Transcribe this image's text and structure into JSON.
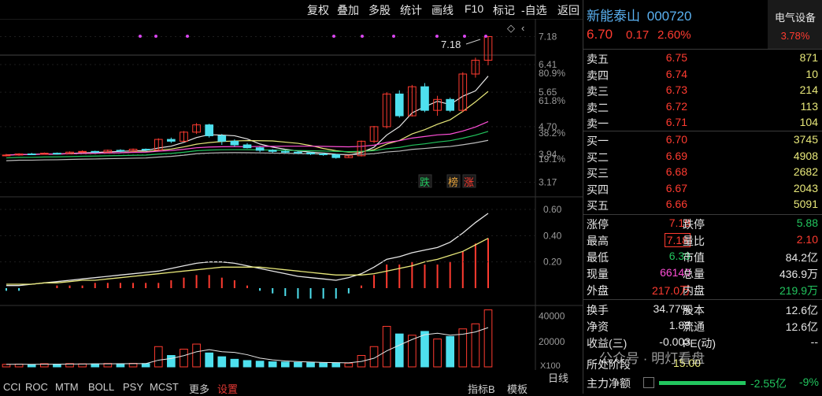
{
  "toolbar": {
    "buttons": [
      "复权",
      "叠加",
      "多股",
      "统计",
      "画线",
      "F10",
      "标记",
      "-自选",
      "返回"
    ]
  },
  "stock": {
    "name": "新能泰山",
    "code": "000720",
    "sector": "电气设备",
    "sector_change": "3.78%",
    "price": "6.70",
    "change": "0.17",
    "change_pct": "2.60%"
  },
  "order_book": {
    "asks": [
      {
        "label": "卖五",
        "price": "6.75",
        "vol": "871"
      },
      {
        "label": "卖四",
        "price": "6.74",
        "vol": "10"
      },
      {
        "label": "卖三",
        "price": "6.73",
        "vol": "214"
      },
      {
        "label": "卖二",
        "price": "6.72",
        "vol": "113"
      },
      {
        "label": "卖一",
        "price": "6.71",
        "vol": "104"
      }
    ],
    "bids": [
      {
        "label": "买一",
        "price": "6.70",
        "vol": "3745"
      },
      {
        "label": "买二",
        "price": "6.69",
        "vol": "4908"
      },
      {
        "label": "买三",
        "price": "6.68",
        "vol": "2682"
      },
      {
        "label": "买四",
        "price": "6.67",
        "vol": "2043"
      },
      {
        "label": "买五",
        "price": "6.66",
        "vol": "5091"
      }
    ]
  },
  "stats": [
    {
      "l1": "涨停",
      "v1": "7.18",
      "l2": "跌停",
      "v2": "5.88"
    },
    {
      "l1": "最高",
      "v1": "7.18",
      "l2": "量比",
      "v2": "2.10"
    },
    {
      "l1": "最低",
      "v1": "6.39",
      "l2": "市值",
      "v2": "84.2亿"
    },
    {
      "l1": "现量",
      "v1": "66140",
      "l2": "总量",
      "v2": "436.9万"
    },
    {
      "l1": "外盘",
      "v1": "217.0万",
      "l2": "内盘",
      "v2": "219.9万"
    }
  ],
  "fundamentals": [
    {
      "l1": "换手",
      "v1": "34.77%",
      "l2": "股本",
      "v2": "12.6亿"
    },
    {
      "l1": "净资",
      "v1": "1.88",
      "l2": "流通",
      "v2": "12.6亿"
    },
    {
      "l1": "收益(三)",
      "v1": "-0.003",
      "l2": "PE(动)",
      "v2": "--"
    }
  ],
  "footer_rows": {
    "stage_label": "所处阶段",
    "stage_value": "15.00",
    "watermark": "公众号 · 明灯看盘",
    "main_flow_label": "主力净额",
    "main_flow_value": "-2.55亿",
    "main_flow_pct": "-9%"
  },
  "bottom_tabs": {
    "tabs": [
      "CCI",
      "ROC",
      "MTM",
      "BOLL",
      "PSY",
      "MCST",
      "更多",
      "设置"
    ],
    "right_tabs": [
      "指标B",
      "模板"
    ],
    "day_label": "日线"
  },
  "chart_data": {
    "type": "candlestick",
    "price_axis": [
      "7.18",
      "6.41",
      "5.65",
      "4.70",
      "3.94",
      "3.17"
    ],
    "price_range": [
      2.9,
      7.45
    ],
    "pct_labels": [
      "80.9%",
      "61.8%",
      "38.2%",
      "19.1%"
    ],
    "max_marker": "7.18",
    "signal_labels": [
      "跌",
      "榜",
      "涨"
    ],
    "candles": [
      [
        3.9,
        3.92,
        3.88,
        3.95
      ],
      [
        3.92,
        3.95,
        3.9,
        3.97
      ],
      [
        3.95,
        3.94,
        3.92,
        3.98
      ],
      [
        3.94,
        3.97,
        3.93,
        3.99
      ],
      [
        3.97,
        3.96,
        3.93,
        3.99
      ],
      [
        3.96,
        4.0,
        3.95,
        4.02
      ],
      [
        4.0,
        4.02,
        3.98,
        4.05
      ],
      [
        4.02,
        4.0,
        3.97,
        4.04
      ],
      [
        4.0,
        4.05,
        3.99,
        4.07
      ],
      [
        4.05,
        4.03,
        4.0,
        4.08
      ],
      [
        4.03,
        4.08,
        4.02,
        4.1
      ],
      [
        4.08,
        4.06,
        4.03,
        4.1
      ],
      [
        4.06,
        4.35,
        4.05,
        4.38
      ],
      [
        4.35,
        4.3,
        4.25,
        4.4
      ],
      [
        4.3,
        4.55,
        4.28,
        4.58
      ],
      [
        4.55,
        4.75,
        4.5,
        4.8
      ],
      [
        4.75,
        4.45,
        4.4,
        4.78
      ],
      [
        4.45,
        4.3,
        4.2,
        4.5
      ],
      [
        4.3,
        4.2,
        4.15,
        4.35
      ],
      [
        4.2,
        4.12,
        4.1,
        4.25
      ],
      [
        4.12,
        4.05,
        4.0,
        4.15
      ],
      [
        4.05,
        4.02,
        3.98,
        4.08
      ],
      [
        4.02,
        4.0,
        3.96,
        4.05
      ],
      [
        4.0,
        3.98,
        3.95,
        4.03
      ],
      [
        3.98,
        3.95,
        3.92,
        4.0
      ],
      [
        3.95,
        3.93,
        3.9,
        3.98
      ],
      [
        3.93,
        3.85,
        3.82,
        3.95
      ],
      [
        3.85,
        3.9,
        3.84,
        3.92
      ],
      [
        3.9,
        4.3,
        3.88,
        4.32
      ],
      [
        4.3,
        4.7,
        4.25,
        4.72
      ],
      [
        4.7,
        5.6,
        4.65,
        5.65
      ],
      [
        5.6,
        5.0,
        4.95,
        5.7
      ],
      [
        5.0,
        5.8,
        4.98,
        5.85
      ],
      [
        5.8,
        5.15,
        5.1,
        5.9
      ],
      [
        5.15,
        5.45,
        5.0,
        5.55
      ],
      [
        5.45,
        5.15,
        5.1,
        5.5
      ],
      [
        5.15,
        6.15,
        5.1,
        6.2
      ],
      [
        6.15,
        6.53,
        6.05,
        6.6
      ],
      [
        6.53,
        7.18,
        6.39,
        7.18
      ]
    ],
    "macd_axis": [
      "0.60",
      "0.40",
      "0.20"
    ],
    "macd_range": [
      -0.12,
      0.66
    ],
    "dif": [
      0.02,
      0.02,
      0.03,
      0.04,
      0.05,
      0.06,
      0.07,
      0.08,
      0.09,
      0.1,
      0.11,
      0.12,
      0.13,
      0.15,
      0.17,
      0.19,
      0.2,
      0.2,
      0.19,
      0.17,
      0.15,
      0.13,
      0.11,
      0.09,
      0.08,
      0.07,
      0.06,
      0.08,
      0.11,
      0.16,
      0.22,
      0.24,
      0.27,
      0.29,
      0.31,
      0.35,
      0.42,
      0.5,
      0.57
    ],
    "dea": [
      0.03,
      0.03,
      0.03,
      0.04,
      0.04,
      0.05,
      0.06,
      0.06,
      0.07,
      0.08,
      0.09,
      0.1,
      0.11,
      0.12,
      0.13,
      0.14,
      0.15,
      0.16,
      0.16,
      0.16,
      0.16,
      0.15,
      0.14,
      0.13,
      0.12,
      0.11,
      0.1,
      0.1,
      0.1,
      0.11,
      0.13,
      0.15,
      0.17,
      0.2,
      0.22,
      0.25,
      0.28,
      0.33,
      0.38
    ],
    "macd": [
      -0.02,
      -0.02,
      0.0,
      0.0,
      0.02,
      0.02,
      0.02,
      0.04,
      0.04,
      0.04,
      0.04,
      0.04,
      0.04,
      0.06,
      0.08,
      0.1,
      0.1,
      0.08,
      0.06,
      0.02,
      -0.02,
      -0.04,
      -0.06,
      -0.08,
      -0.08,
      -0.08,
      -0.08,
      -0.04,
      0.02,
      0.1,
      0.18,
      0.18,
      0.2,
      0.18,
      0.18,
      0.2,
      0.28,
      0.34,
      0.38
    ],
    "vol_axis": [
      "40000",
      "20000"
    ],
    "vol_unit": "X100",
    "vol_max": 46000,
    "volume": [
      2000,
      2200,
      1800,
      2500,
      2100,
      2600,
      2400,
      2300,
      2700,
      2500,
      2800,
      2600,
      16000,
      9000,
      14000,
      18000,
      11000,
      8000,
      6000,
      5000,
      4500,
      4000,
      3800,
      3500,
      3300,
      3000,
      3200,
      2900,
      9000,
      16000,
      32000,
      26000,
      25000,
      28000,
      22000,
      24000,
      30000,
      34000,
      45000
    ]
  }
}
